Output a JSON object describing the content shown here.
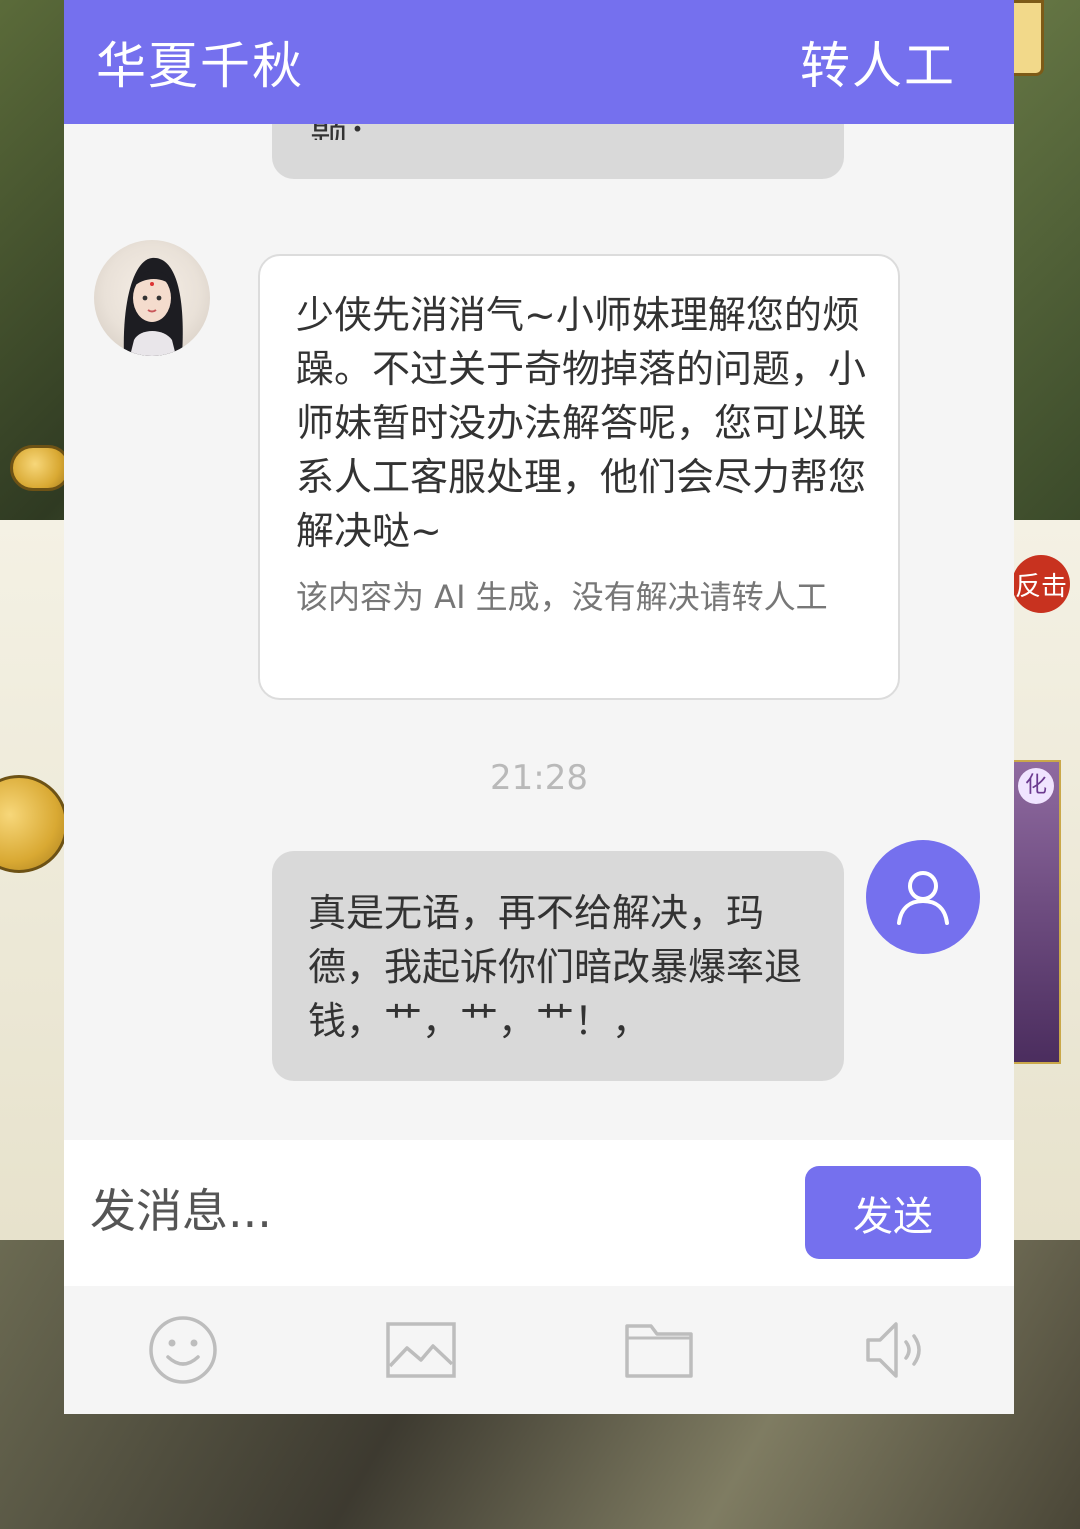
{
  "header": {
    "title": "华夏千秋",
    "transfer_label": "转人工"
  },
  "messages": {
    "prev_cut_text": "题：",
    "bot": {
      "text": "少侠先消消气~小师妹理解您的烦躁。不过关于奇物掉落的问题，小师妹暂时没办法解答呢，您可以联系人工客服处理，他们会尽力帮您解决哒~",
      "note": "该内容为 AI 生成，没有解决请转人工"
    },
    "timestamp": "21:28",
    "user": {
      "text": "真是无语，再不给解决，玛德，我起诉你们暗改暴爆率退钱，艹，艹，艹！，"
    }
  },
  "input": {
    "placeholder": "发消息...",
    "send_label": "发送"
  },
  "toolbar": {
    "icons": [
      "smiley-icon",
      "image-icon",
      "folder-icon",
      "speaker-icon"
    ]
  },
  "background": {
    "badge_text": "反击",
    "card_tag": "化"
  },
  "colors": {
    "accent": "#7570ee",
    "bot_bubble": "#ffffff",
    "user_bubble": "#d9d9d9"
  }
}
